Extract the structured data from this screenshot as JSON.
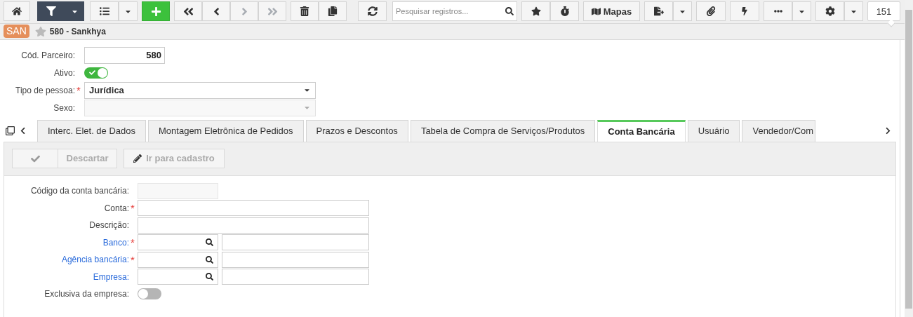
{
  "toolbar": {
    "filter_active": true,
    "nav_buttons": [
      {
        "kind": "first",
        "disabled": false
      },
      {
        "kind": "previous",
        "disabled": false
      },
      {
        "kind": "next",
        "disabled": true
      },
      {
        "kind": "last",
        "disabled": true
      }
    ],
    "search": {
      "placeholder": "Pesquisar registros..."
    },
    "maps_button": "Mapas",
    "record_count": "151"
  },
  "required_mark": "*",
  "header": {
    "badge": "SAN",
    "favorite": false,
    "title": "580 - Sankhya"
  },
  "partner_form": [
    {
      "kind": "number",
      "label": "Cód. Parceiro:",
      "value": "580"
    },
    {
      "kind": "toggle",
      "label": "Ativo:",
      "on": true
    },
    {
      "kind": "select",
      "label": "Tipo de pessoa:",
      "required": true,
      "value": "Jurídica",
      "disabled": false
    },
    {
      "kind": "select",
      "label": "Sexo:",
      "required": false,
      "disabled": true
    }
  ],
  "tabs": [
    {
      "label": "Interc. Elet. de Dados",
      "selected": false
    },
    {
      "label": "Montagem Eletrônica de Pedidos",
      "selected": false
    },
    {
      "label": "Prazos e Descontos",
      "selected": false
    },
    {
      "label": "Tabela de Compra de Serviços/Produtos",
      "selected": false
    },
    {
      "label": "Conta Bancária",
      "selected": true
    },
    {
      "label": "Usuário",
      "selected": false
    },
    {
      "label": "Vendedor/Com",
      "selected": false
    }
  ],
  "detail_toolbar": {
    "confirm_disabled": true,
    "discard": {
      "label": "Descartar",
      "disabled": true
    },
    "goto": {
      "label": "Ir para cadastro",
      "disabled": true
    }
  },
  "bank_form": [
    {
      "kind": "code",
      "label": "Código da conta bancária:",
      "required": false,
      "link": false,
      "disabled": true
    },
    {
      "kind": "text",
      "label": "Conta:",
      "required": true,
      "link": false,
      "disabled": false
    },
    {
      "kind": "text",
      "label": "Descrição:",
      "required": false,
      "link": false,
      "disabled": false
    },
    {
      "kind": "lookup",
      "label": "Banco:",
      "required": true,
      "link": true
    },
    {
      "kind": "lookup",
      "label": "Agência bancária:",
      "required": true,
      "link": true
    },
    {
      "kind": "lookup",
      "label": "Empresa:",
      "required": false,
      "link": true
    },
    {
      "kind": "toggle",
      "label": "Exclusiva da empresa:",
      "on": false
    }
  ]
}
